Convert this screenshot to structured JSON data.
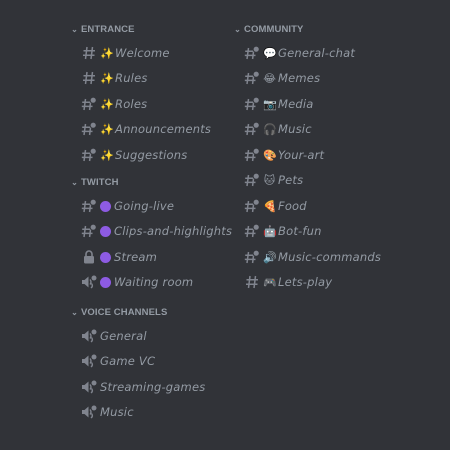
{
  "left": {
    "entrance": {
      "title": "ENTRANCE",
      "channels": [
        {
          "emoji": "✨",
          "label": "Welcome"
        },
        {
          "emoji": "✨",
          "label": "Rules"
        },
        {
          "emoji": "✨",
          "label": "Roles"
        },
        {
          "emoji": "✨",
          "label": "Announcements"
        },
        {
          "emoji": "✨",
          "label": "Suggestions"
        }
      ]
    },
    "twitch": {
      "title": "TWITCH",
      "channels": [
        {
          "label": "Going-live"
        },
        {
          "label": "Clips-and-highlights"
        },
        {
          "label": "Stream"
        },
        {
          "label": "Waiting room"
        }
      ]
    },
    "voice": {
      "title": "VOICE CHANNELS",
      "channels": [
        {
          "label": "General"
        },
        {
          "label": "Game VC"
        },
        {
          "label": "Streaming-games"
        },
        {
          "label": "Music"
        }
      ]
    }
  },
  "community": {
    "title": "COMMUNITY",
    "channels": [
      {
        "emoji": "💬",
        "label": "General-chat"
      },
      {
        "emoji": "😂",
        "label": "Memes"
      },
      {
        "emoji": "📷",
        "label": "Media"
      },
      {
        "emoji": "🎧",
        "label": "Music"
      },
      {
        "emoji": "🎨",
        "label": "Your-art"
      },
      {
        "emoji": "🐱",
        "label": "Pets"
      },
      {
        "emoji": "🍕",
        "label": "Food"
      },
      {
        "emoji": "🤖",
        "label": "Bot-fun"
      },
      {
        "emoji": "🔊",
        "label": "Music-commands"
      },
      {
        "emoji": "🎮",
        "label": "Lets-play"
      }
    ]
  },
  "colors": {
    "background": "#313338",
    "text": "#949ba4",
    "twitch_purple": "#8d5be3"
  }
}
